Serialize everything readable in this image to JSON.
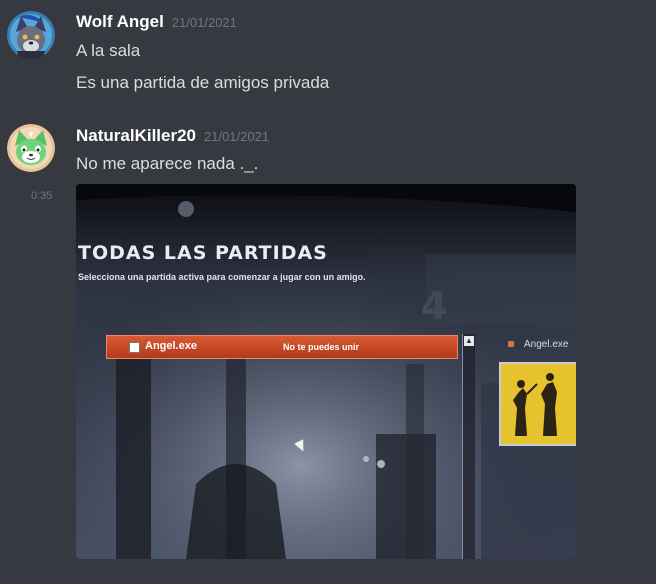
{
  "messages": [
    {
      "author": "Wolf Angel",
      "timestamp": "21/01/2021",
      "lines": [
        "A la sala",
        "Es una partida de amigos privada"
      ]
    },
    {
      "author": "NaturalKiller20",
      "timestamp": "21/01/2021",
      "lines": [
        "No me aparece nada ._."
      ],
      "hover_time": "0:35"
    }
  ],
  "attachment": {
    "title": "TODAS LAS PARTIDAS",
    "subtitle": "Selecciona una partida activa para comenzar a jugar con un amigo.",
    "row_name": "Angel.exe",
    "row_status": "No te puedes unir",
    "side_name": "Angel.exe"
  },
  "colors": {
    "background": "#36393f",
    "username": "#ffffff",
    "message_text": "#dcddde",
    "timestamp": "#72767d",
    "highlight_row": "#c9482a"
  },
  "icons": {
    "wolf_avatar": "wolf-avatar",
    "cat_avatar": "cat-avatar",
    "scroll_up": "scroll-up-icon",
    "cursor": "mouse-cursor-icon"
  }
}
